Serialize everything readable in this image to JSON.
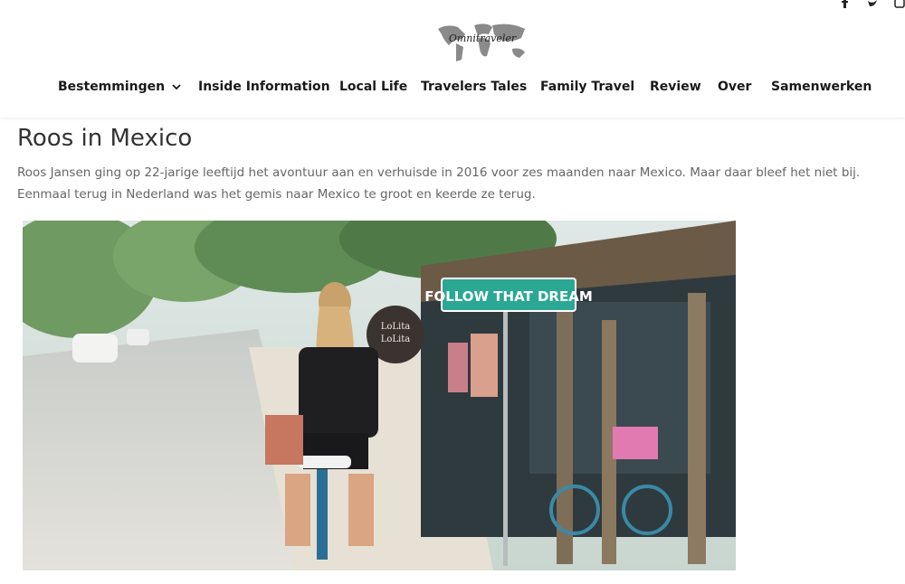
{
  "header": {
    "logo_text": "Omnitraveler",
    "nav": [
      {
        "label": "Bestemmingen",
        "has_dropdown": true
      },
      {
        "label": "Inside Information"
      },
      {
        "label": "Local Life"
      },
      {
        "label": "Travelers Tales"
      },
      {
        "label": "Family Travel"
      },
      {
        "label": "Review"
      },
      {
        "label": "Over"
      },
      {
        "label": "Samenwerken"
      }
    ],
    "social_icons": [
      "facebook-icon",
      "twitter-icon",
      "instagram-icon"
    ]
  },
  "article": {
    "title": "Roos in Mexico",
    "intro": "Roos Jansen ging op 22-jarige leeftijd het avontuur aan en verhuisde in 2016 voor zes maanden naar Mexico. Maar daar bleef het niet bij. Eenmaal terug in Nederland was het gemis naar Mexico te groot en keerde ze terug.",
    "photo": {
      "sign_text": "FOLLOW THAT DREAM",
      "shop_sign_lines": [
        "LoLita",
        "LoLita"
      ]
    }
  },
  "colors": {
    "nav_text": "#1a1a1a",
    "body_text": "#666666",
    "title_text": "#333333",
    "sign_green": "#2aa893"
  }
}
